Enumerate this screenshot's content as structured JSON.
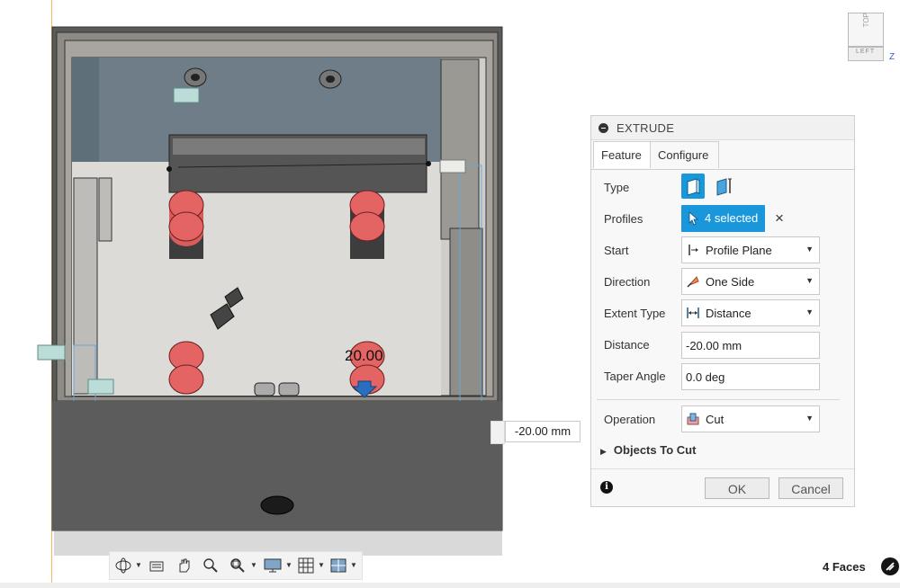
{
  "viewcube": {
    "top_label": "TOP",
    "left_label": "LEFT",
    "axis_label": "Z"
  },
  "viewport": {
    "dimension_overlay": "20.00",
    "dimension_value": "-20.00 mm"
  },
  "dialog": {
    "title": "EXTRUDE",
    "tabs": [
      {
        "label": "Feature"
      },
      {
        "label": "Configure"
      }
    ],
    "rows": {
      "type": {
        "label": "Type"
      },
      "profiles": {
        "label": "Profiles",
        "value": "4 selected",
        "clear_icon": "×"
      },
      "start": {
        "label": "Start",
        "value": "Profile Plane"
      },
      "direction": {
        "label": "Direction",
        "value": "One Side"
      },
      "extent_type": {
        "label": "Extent Type",
        "value": "Distance"
      },
      "distance": {
        "label": "Distance",
        "value": "-20.00 mm"
      },
      "taper_angle": {
        "label": "Taper Angle",
        "value": "0.0 deg"
      },
      "operation": {
        "label": "Operation",
        "value": "Cut"
      }
    },
    "objects_to_cut": "Objects To Cut",
    "info_glyph": "i",
    "ok_label": "OK",
    "cancel_label": "Cancel"
  },
  "toolbar": {
    "items": [
      "orbit-icon",
      "look-at-icon",
      "pan-icon",
      "zoom-icon",
      "fit-icon",
      "display-settings-icon",
      "grid-icon",
      "viewports-icon"
    ]
  },
  "status": {
    "selection": "4 Faces"
  },
  "colors": {
    "accent": "#1a97db",
    "cylinder": "#e46464",
    "body": "#5a5a5a"
  }
}
